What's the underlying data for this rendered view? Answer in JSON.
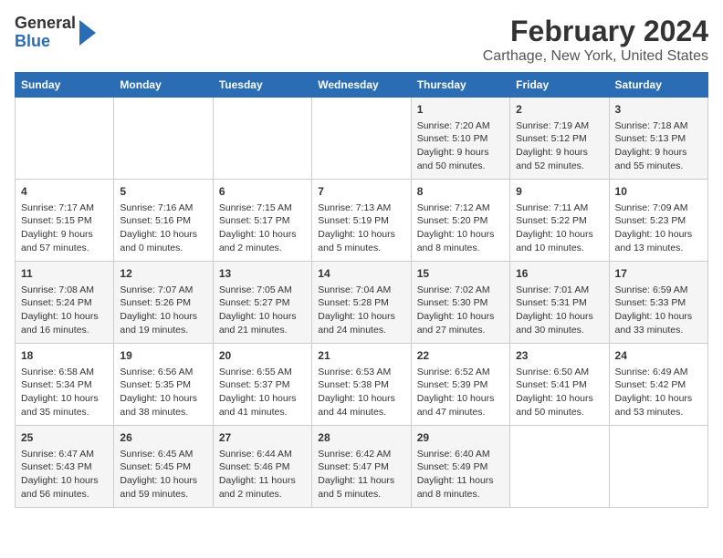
{
  "header": {
    "logo_general": "General",
    "logo_blue": "Blue",
    "title": "February 2024",
    "subtitle": "Carthage, New York, United States"
  },
  "columns": [
    "Sunday",
    "Monday",
    "Tuesday",
    "Wednesday",
    "Thursday",
    "Friday",
    "Saturday"
  ],
  "weeks": [
    [
      {
        "day": "",
        "info": ""
      },
      {
        "day": "",
        "info": ""
      },
      {
        "day": "",
        "info": ""
      },
      {
        "day": "",
        "info": ""
      },
      {
        "day": "1",
        "info": "Sunrise: 7:20 AM\nSunset: 5:10 PM\nDaylight: 9 hours and 50 minutes."
      },
      {
        "day": "2",
        "info": "Sunrise: 7:19 AM\nSunset: 5:12 PM\nDaylight: 9 hours and 52 minutes."
      },
      {
        "day": "3",
        "info": "Sunrise: 7:18 AM\nSunset: 5:13 PM\nDaylight: 9 hours and 55 minutes."
      }
    ],
    [
      {
        "day": "4",
        "info": "Sunrise: 7:17 AM\nSunset: 5:15 PM\nDaylight: 9 hours and 57 minutes."
      },
      {
        "day": "5",
        "info": "Sunrise: 7:16 AM\nSunset: 5:16 PM\nDaylight: 10 hours and 0 minutes."
      },
      {
        "day": "6",
        "info": "Sunrise: 7:15 AM\nSunset: 5:17 PM\nDaylight: 10 hours and 2 minutes."
      },
      {
        "day": "7",
        "info": "Sunrise: 7:13 AM\nSunset: 5:19 PM\nDaylight: 10 hours and 5 minutes."
      },
      {
        "day": "8",
        "info": "Sunrise: 7:12 AM\nSunset: 5:20 PM\nDaylight: 10 hours and 8 minutes."
      },
      {
        "day": "9",
        "info": "Sunrise: 7:11 AM\nSunset: 5:22 PM\nDaylight: 10 hours and 10 minutes."
      },
      {
        "day": "10",
        "info": "Sunrise: 7:09 AM\nSunset: 5:23 PM\nDaylight: 10 hours and 13 minutes."
      }
    ],
    [
      {
        "day": "11",
        "info": "Sunrise: 7:08 AM\nSunset: 5:24 PM\nDaylight: 10 hours and 16 minutes."
      },
      {
        "day": "12",
        "info": "Sunrise: 7:07 AM\nSunset: 5:26 PM\nDaylight: 10 hours and 19 minutes."
      },
      {
        "day": "13",
        "info": "Sunrise: 7:05 AM\nSunset: 5:27 PM\nDaylight: 10 hours and 21 minutes."
      },
      {
        "day": "14",
        "info": "Sunrise: 7:04 AM\nSunset: 5:28 PM\nDaylight: 10 hours and 24 minutes."
      },
      {
        "day": "15",
        "info": "Sunrise: 7:02 AM\nSunset: 5:30 PM\nDaylight: 10 hours and 27 minutes."
      },
      {
        "day": "16",
        "info": "Sunrise: 7:01 AM\nSunset: 5:31 PM\nDaylight: 10 hours and 30 minutes."
      },
      {
        "day": "17",
        "info": "Sunrise: 6:59 AM\nSunset: 5:33 PM\nDaylight: 10 hours and 33 minutes."
      }
    ],
    [
      {
        "day": "18",
        "info": "Sunrise: 6:58 AM\nSunset: 5:34 PM\nDaylight: 10 hours and 35 minutes."
      },
      {
        "day": "19",
        "info": "Sunrise: 6:56 AM\nSunset: 5:35 PM\nDaylight: 10 hours and 38 minutes."
      },
      {
        "day": "20",
        "info": "Sunrise: 6:55 AM\nSunset: 5:37 PM\nDaylight: 10 hours and 41 minutes."
      },
      {
        "day": "21",
        "info": "Sunrise: 6:53 AM\nSunset: 5:38 PM\nDaylight: 10 hours and 44 minutes."
      },
      {
        "day": "22",
        "info": "Sunrise: 6:52 AM\nSunset: 5:39 PM\nDaylight: 10 hours and 47 minutes."
      },
      {
        "day": "23",
        "info": "Sunrise: 6:50 AM\nSunset: 5:41 PM\nDaylight: 10 hours and 50 minutes."
      },
      {
        "day": "24",
        "info": "Sunrise: 6:49 AM\nSunset: 5:42 PM\nDaylight: 10 hours and 53 minutes."
      }
    ],
    [
      {
        "day": "25",
        "info": "Sunrise: 6:47 AM\nSunset: 5:43 PM\nDaylight: 10 hours and 56 minutes."
      },
      {
        "day": "26",
        "info": "Sunrise: 6:45 AM\nSunset: 5:45 PM\nDaylight: 10 hours and 59 minutes."
      },
      {
        "day": "27",
        "info": "Sunrise: 6:44 AM\nSunset: 5:46 PM\nDaylight: 11 hours and 2 minutes."
      },
      {
        "day": "28",
        "info": "Sunrise: 6:42 AM\nSunset: 5:47 PM\nDaylight: 11 hours and 5 minutes."
      },
      {
        "day": "29",
        "info": "Sunrise: 6:40 AM\nSunset: 5:49 PM\nDaylight: 11 hours and 8 minutes."
      },
      {
        "day": "",
        "info": ""
      },
      {
        "day": "",
        "info": ""
      }
    ]
  ]
}
